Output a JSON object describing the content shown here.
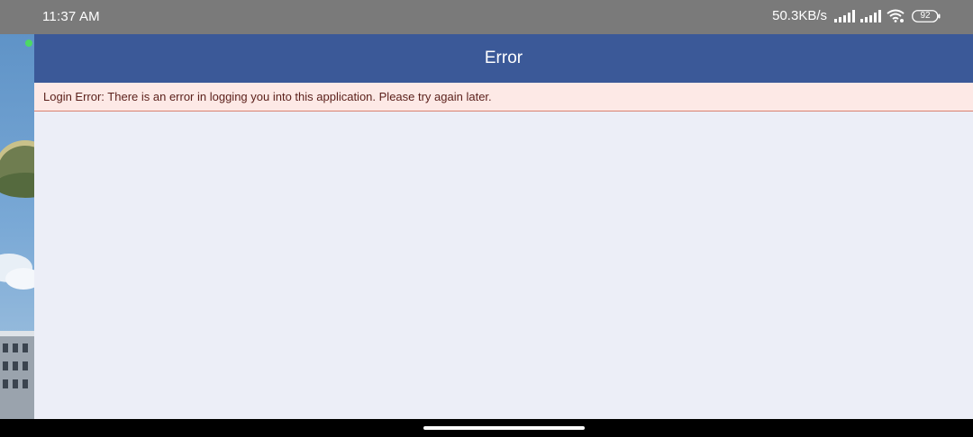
{
  "status_bar": {
    "time": "11:37 AM",
    "net_speed": "50.3KB/s",
    "battery": "92"
  },
  "app": {
    "title": "Error",
    "error_message": "Login Error: There is an error in logging you into this application. Please try again later."
  },
  "colors": {
    "header": "#3b5998",
    "banner_bg": "#fde9e6",
    "banner_border": "#d9806f",
    "banner_text": "#5a1f1a",
    "content_bg": "#eceef7",
    "status_bar": "#7a7a7a"
  },
  "icons": {
    "signal_1": "cell-signal-icon",
    "signal_2": "cell-signal-icon",
    "wifi": "wifi-icon",
    "battery": "battery-icon"
  }
}
